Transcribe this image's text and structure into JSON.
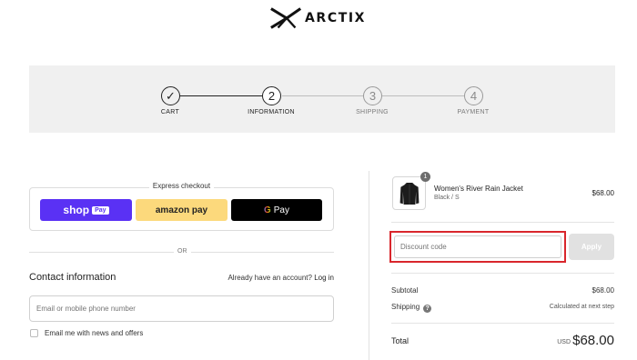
{
  "brand": {
    "name": "ARCTIX",
    "logo_icon": "arctix-logo-icon"
  },
  "progress": {
    "steps": [
      {
        "label": "CART",
        "number": "✓",
        "state": "done"
      },
      {
        "label": "INFORMATION",
        "number": "2",
        "state": "current"
      },
      {
        "label": "SHIPPING",
        "number": "3",
        "state": "future"
      },
      {
        "label": "PAYMENT",
        "number": "4",
        "state": "future"
      }
    ]
  },
  "express": {
    "title": "Express checkout",
    "shop_pay_label": "shop",
    "shop_pay_badge": "Pay",
    "amazon_pay_label": "amazon pay",
    "google_pay_g": "G",
    "google_pay_label": "Pay",
    "or_text": "OR"
  },
  "contact": {
    "title": "Contact information",
    "account_prompt": "Already have an account?",
    "login_label": "Log in",
    "email_placeholder": "Email or mobile phone number",
    "newsletter_label": "Email me with news and offers"
  },
  "order": {
    "item": {
      "quantity": "1",
      "name": "Women's River Rain Jacket",
      "variant": "Black / S",
      "price": "$68.00"
    },
    "discount_placeholder": "Discount code",
    "apply_label": "Apply",
    "subtotal_label": "Subtotal",
    "subtotal_value": "$68.00",
    "shipping_label": "Shipping",
    "shipping_help": "?",
    "shipping_value": "Calculated at next step",
    "total_label": "Total",
    "currency": "USD",
    "total_value": "$68.00"
  },
  "colors": {
    "shop_pay": "#5a31f4",
    "amazon_pay": "#fcd97c",
    "google_pay": "#000000",
    "highlight_border": "#d9262c"
  }
}
